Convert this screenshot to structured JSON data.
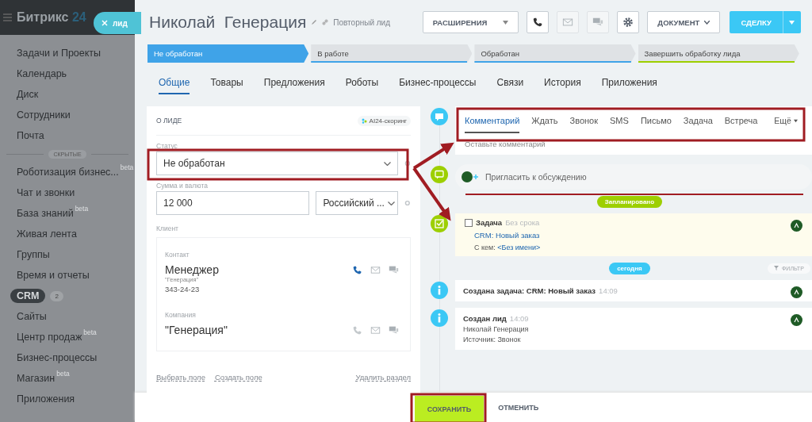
{
  "sidebar": {
    "logo": {
      "name": "Битрикс",
      "number": "24"
    },
    "items": [
      {
        "kind": "item",
        "label": "Задачи и Проекты",
        "selected": false
      },
      {
        "kind": "item",
        "label": "Календарь",
        "selected": false
      },
      {
        "kind": "item",
        "label": "Диск",
        "selected": false
      },
      {
        "kind": "item",
        "label": "Сотрудники",
        "selected": false
      },
      {
        "kind": "item",
        "label": "Почта",
        "selected": false
      },
      {
        "kind": "divider",
        "label": "СКРЫТЫЕ"
      },
      {
        "kind": "item",
        "label": "Роботизация бизнес...",
        "badge": "beta",
        "selected": false
      },
      {
        "kind": "item",
        "label": "Чат и звонки",
        "selected": false
      },
      {
        "kind": "item",
        "label": "База знаний",
        "badge": "beta",
        "selected": false
      },
      {
        "kind": "item",
        "label": "Живая лента",
        "selected": false
      },
      {
        "kind": "item",
        "label": "Группы",
        "selected": false
      },
      {
        "kind": "item",
        "label": "Время и отчеты",
        "selected": false
      },
      {
        "kind": "item",
        "label": "CRM",
        "counter": "2",
        "selected": true
      },
      {
        "kind": "item",
        "label": "Сайты",
        "selected": false
      },
      {
        "kind": "item",
        "label": "Центр продаж",
        "badge": "beta",
        "selected": false
      },
      {
        "kind": "item",
        "label": "Бизнес-процессы",
        "selected": false
      },
      {
        "kind": "item",
        "label": "Магазин",
        "badge": "beta",
        "selected": false
      },
      {
        "kind": "item",
        "label": "Приложения",
        "selected": false
      }
    ]
  },
  "slider_tab": {
    "label": "лид"
  },
  "header": {
    "title": "Николай  Генерация",
    "subtitle": "Повторный лид",
    "extensions_button": "РАСШИРЕНИЯ",
    "document_button": "ДОКУМЕНТ",
    "convert_button": "СДЕЛКУ"
  },
  "stages": [
    {
      "label": "Не обработан",
      "selected": true,
      "color": "#3fa3e8"
    },
    {
      "label": "В работе",
      "selected": false,
      "color": "#3fa3e8"
    },
    {
      "label": "Обработан",
      "selected": false,
      "color": "#3fa3e8"
    },
    {
      "label": "Завершить обработку лида",
      "selected": false,
      "color": "#9dcf00"
    }
  ],
  "tabs": [
    {
      "label": "Общие",
      "selected": true
    },
    {
      "label": "Товары",
      "selected": false
    },
    {
      "label": "Предложения",
      "selected": false
    },
    {
      "label": "Роботы",
      "selected": false
    },
    {
      "label": "Бизнес-процессы",
      "selected": false
    },
    {
      "label": "Связи",
      "selected": false
    },
    {
      "label": "История",
      "selected": false
    },
    {
      "label": "Приложения",
      "selected": false
    }
  ],
  "lead_card": {
    "title": "О ЛИДЕ",
    "scoring_badge": "AI24-скоринг",
    "status": {
      "label": "Статус",
      "value": "Не обработан"
    },
    "amount": {
      "label": "Сумма и валюта",
      "value": "12 000",
      "currency": "Российский ..."
    },
    "client": {
      "label": "Клиент",
      "contact_label": "Контакт",
      "contact_name": "Менеджер",
      "contact_company": "\"Генерация\"",
      "contact_phone": "343-24-23",
      "company_label": "Компания",
      "company_name": "\"Генерация\""
    },
    "links": [
      "Выбрать поле",
      "Создать поле"
    ],
    "delete_link": "Удалить раздел"
  },
  "timeline": {
    "composer_tabs": [
      {
        "label": "Комментарий",
        "selected": true
      },
      {
        "label": "Ждать",
        "selected": false
      },
      {
        "label": "Звонок",
        "selected": false
      },
      {
        "label": "SMS",
        "selected": false
      },
      {
        "label": "Письмо",
        "selected": false
      },
      {
        "label": "Задача",
        "selected": false
      },
      {
        "label": "Встреча",
        "selected": false
      }
    ],
    "more": "Ещё",
    "comment_placeholder": "Оставьте комментарий",
    "invite": "Пригласить к обсуждению",
    "planned_label": "Запланировано",
    "task": {
      "checked": false,
      "title": "Задача",
      "deadline": "Без срока",
      "link": "CRM: Новый заказ",
      "with_label": "С кем:",
      "with_value": "<Без имени>"
    },
    "today_label": "сегодня",
    "filter": "ФИЛЬТР",
    "events": [
      {
        "title": "Создана задача: CRM: Новый заказ",
        "time": "14:09"
      },
      {
        "title": "Создан лид",
        "time": "14:09",
        "lines": [
          "Николай Генерация",
          "Источник: Звонок"
        ]
      }
    ]
  },
  "footer": {
    "save": "СОХРАНИТЬ",
    "cancel": "ОТМЕНИТЬ"
  }
}
